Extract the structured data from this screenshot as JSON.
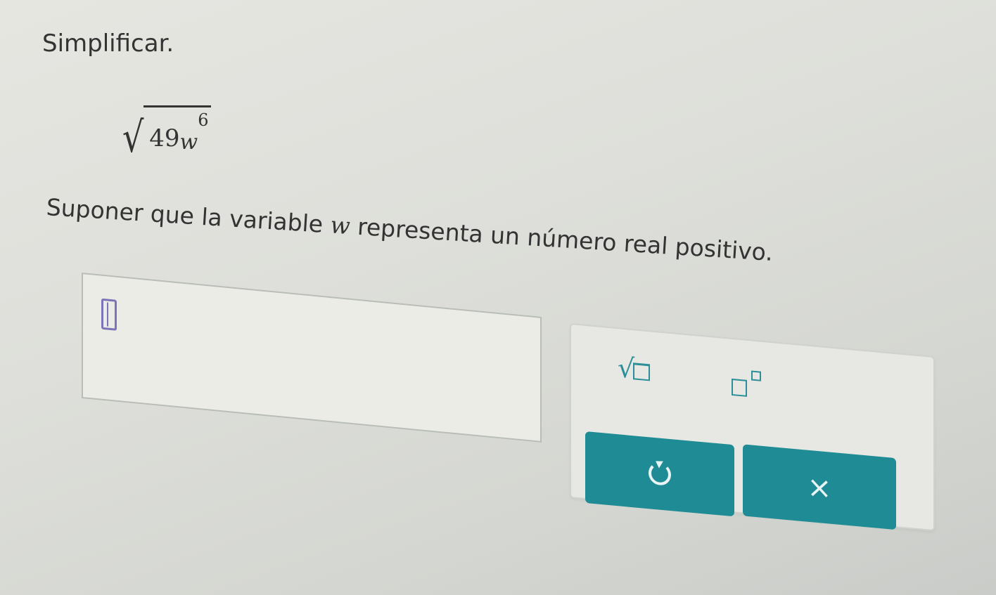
{
  "instruction": "Simplificar.",
  "expression": {
    "radical": "√",
    "coefficient": "49",
    "variable": "w",
    "exponent": "6"
  },
  "assumption": {
    "before": "Suponer que la variable ",
    "variable": "w",
    "after": " representa un número real positivo."
  },
  "answer": {
    "value": ""
  },
  "palette": {
    "sqrt_tool_icon": "square-root-icon",
    "power_tool_icon": "exponent-icon",
    "undo_icon": "undo-icon",
    "clear_label": "×"
  },
  "colors": {
    "accent": "#1f8c95",
    "tool": "#2b8e98",
    "cursor": "#7b74b8"
  }
}
